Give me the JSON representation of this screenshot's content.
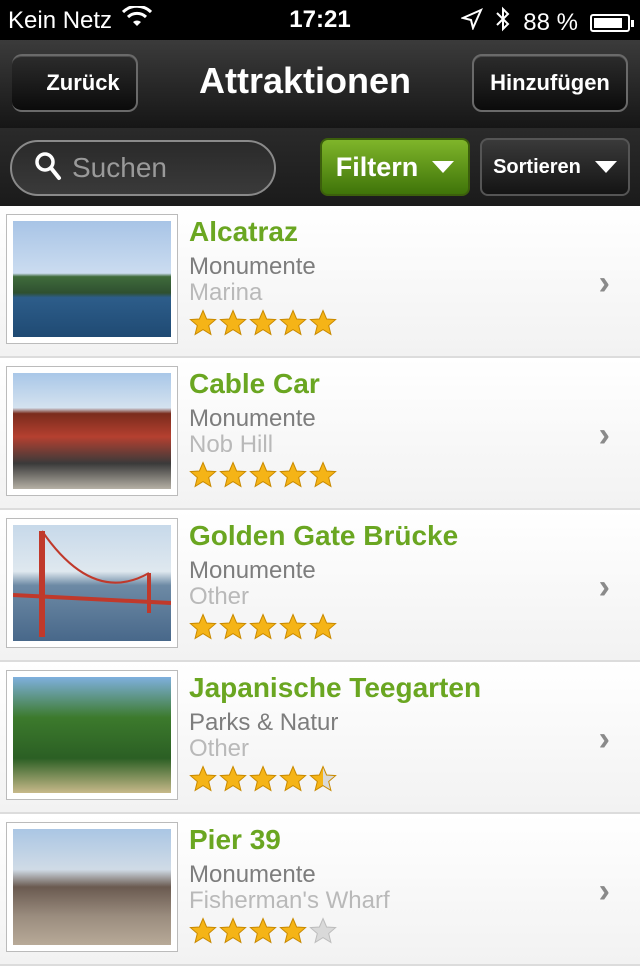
{
  "status_bar": {
    "carrier": "Kein Netz",
    "time": "17:21",
    "battery": "88 %",
    "battery_level": 0.88
  },
  "nav": {
    "back_label": "Zurück",
    "title": "Attraktionen",
    "add_label": "Hinzufügen"
  },
  "toolbar": {
    "search_placeholder": "Suchen",
    "filter_label": "Filtern",
    "sort_label": "Sortieren"
  },
  "colors": {
    "title_green": "#6aa621",
    "star_gold": "#f5b417",
    "star_empty": "#d9d9d9"
  },
  "list": {
    "items": [
      {
        "title": "Alcatraz",
        "category": "Monumente",
        "area": "Marina",
        "rating": 5
      },
      {
        "title": "Cable Car",
        "category": "Monumente",
        "area": "Nob Hill",
        "rating": 5
      },
      {
        "title": "Golden Gate Brücke",
        "category": "Monumente",
        "area": "Other",
        "rating": 5
      },
      {
        "title": "Japanische Teegarten",
        "category": "Parks & Natur",
        "area": "Other",
        "rating": 4.5
      },
      {
        "title": "Pier 39",
        "category": "Monumente",
        "area": "Fisherman's Wharf",
        "rating": 4
      }
    ]
  }
}
